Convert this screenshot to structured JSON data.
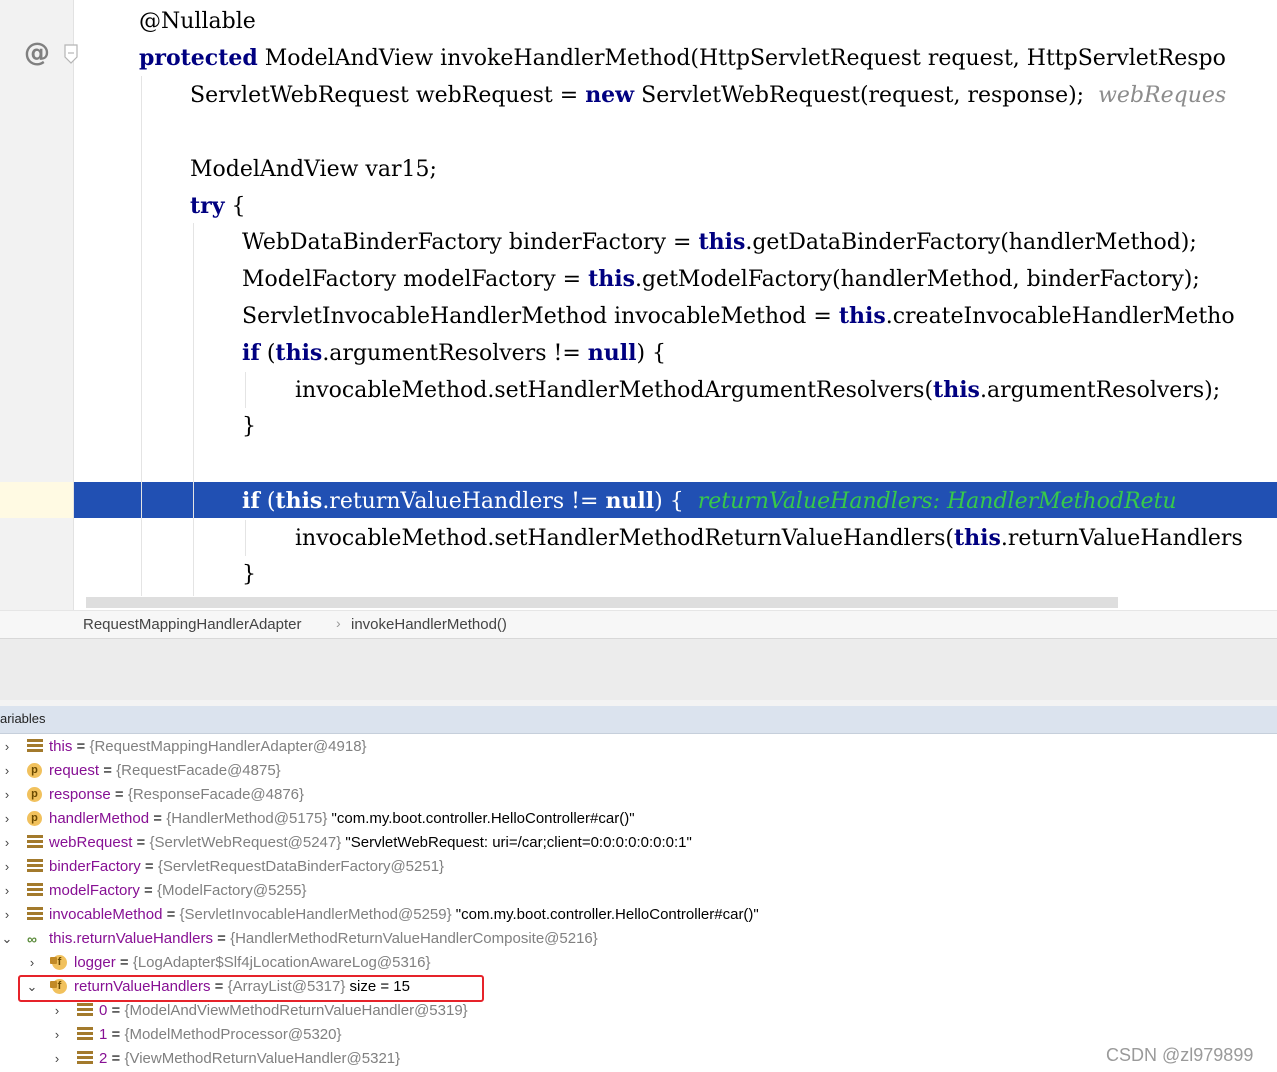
{
  "editor": {
    "gutter_at": "@",
    "lines": [
      {
        "segments": [
          {
            "t": "@Nullable"
          }
        ]
      },
      {
        "segments": [
          {
            "t": "protected",
            "c": "kw"
          },
          {
            "t": " ModelAndView invokeHandlerMethod(HttpServletRequest request, HttpServletRespo"
          }
        ]
      },
      {
        "segments": [
          {
            "t": "ServletWebRequest webRequest = "
          },
          {
            "t": "new",
            "c": "kw"
          },
          {
            "t": " ServletWebRequest(request, response);  "
          },
          {
            "t": "webReques",
            "c": "hint"
          }
        ]
      },
      {
        "segments": [
          {
            "t": "ModelAndView var15;"
          }
        ]
      },
      {
        "segments": [
          {
            "t": "try",
            "c": "kw"
          },
          {
            "t": " {"
          }
        ]
      },
      {
        "segments": [
          {
            "t": "WebDataBinderFactory binderFactory = "
          },
          {
            "t": "this",
            "c": "kw"
          },
          {
            "t": ".getDataBinderFactory(handlerMethod);"
          }
        ]
      },
      {
        "segments": [
          {
            "t": "ModelFactory modelFactory = "
          },
          {
            "t": "this",
            "c": "kw"
          },
          {
            "t": ".getModelFactory(handlerMethod, binderFactory);"
          }
        ]
      },
      {
        "segments": [
          {
            "t": "ServletInvocableHandlerMethod invocableMethod = "
          },
          {
            "t": "this",
            "c": "kw"
          },
          {
            "t": ".createInvocableHandlerMetho"
          }
        ]
      },
      {
        "segments": [
          {
            "t": "if",
            "c": "kw"
          },
          {
            "t": " ("
          },
          {
            "t": "this",
            "c": "kw"
          },
          {
            "t": ".argumentResolvers != "
          },
          {
            "t": "null",
            "c": "kw"
          },
          {
            "t": ") {"
          }
        ]
      },
      {
        "segments": [
          {
            "t": "invocableMethod.setHandlerMethodArgumentResolvers("
          },
          {
            "t": "this",
            "c": "kw"
          },
          {
            "t": ".argumentResolvers);"
          }
        ]
      },
      {
        "segments": [
          {
            "t": "}"
          }
        ]
      },
      {
        "segments": [
          {
            "t": "if",
            "c": "kw"
          },
          {
            "t": " ("
          },
          {
            "t": "this",
            "c": "kw"
          },
          {
            "t": ".returnValueHandlers != "
          },
          {
            "t": "null",
            "c": "kw"
          },
          {
            "t": ") {  "
          },
          {
            "t": "returnValueHandlers: HandlerMethodRetu",
            "c": "hint-green"
          }
        ]
      },
      {
        "segments": [
          {
            "t": "invocableMethod.setHandlerMethodReturnValueHandlers("
          },
          {
            "t": "this",
            "c": "kw"
          },
          {
            "t": ".returnValueHandlers"
          }
        ]
      },
      {
        "segments": [
          {
            "t": "}"
          }
        ]
      }
    ]
  },
  "breadcrumb": {
    "items": [
      "RequestMappingHandlerAdapter",
      "invokeHandlerMethod()"
    ],
    "separator": "›"
  },
  "variables_panel": {
    "title": "ariables",
    "rows": [
      {
        "arrow": "›",
        "icon": "list-icon",
        "name": "this",
        "eq": " = ",
        "value": "{RequestMappingHandlerAdapter@4918}",
        "str": ""
      },
      {
        "arrow": "›",
        "icon": "parameter-icon",
        "name": "request",
        "eq": " = ",
        "value": "{RequestFacade@4875}",
        "str": ""
      },
      {
        "arrow": "›",
        "icon": "parameter-icon",
        "name": "response",
        "eq": " = ",
        "value": "{ResponseFacade@4876}",
        "str": ""
      },
      {
        "arrow": "›",
        "icon": "parameter-icon",
        "name": "handlerMethod",
        "eq": " = ",
        "value": "{HandlerMethod@5175}",
        "str": " \"com.my.boot.controller.HelloController#car()\""
      },
      {
        "arrow": "›",
        "icon": "list-icon",
        "name": "webRequest",
        "eq": " = ",
        "value": "{ServletWebRequest@5247}",
        "str": " \"ServletWebRequest: uri=/car;client=0:0:0:0:0:0:0:1\""
      },
      {
        "arrow": "›",
        "icon": "list-icon",
        "name": "binderFactory",
        "eq": " = ",
        "value": "{ServletRequestDataBinderFactory@5251}",
        "str": ""
      },
      {
        "arrow": "›",
        "icon": "list-icon",
        "name": "modelFactory",
        "eq": " = ",
        "value": "{ModelFactory@5255}",
        "str": ""
      },
      {
        "arrow": "›",
        "icon": "list-icon",
        "name": "invocableMethod",
        "eq": " = ",
        "value": "{ServletInvocableHandlerMethod@5259}",
        "str": " \"com.my.boot.controller.HelloController#car()\""
      },
      {
        "arrow": "⌄",
        "icon": "watch-icon",
        "name": "this.returnValueHandlers",
        "eq": " = ",
        "value": "{HandlerMethodReturnValueHandlerComposite@5216}",
        "str": ""
      },
      {
        "arrow": "›",
        "icon": "field-icon",
        "name": "logger",
        "eq": " = ",
        "value": "{LogAdapter$Slf4jLocationAwareLog@5316}",
        "str": ""
      },
      {
        "arrow": "⌄",
        "icon": "field-icon",
        "name": "returnValueHandlers",
        "eq": " = ",
        "value": "{ArrayList@5317}",
        "str": "  size = 15"
      },
      {
        "arrow": "›",
        "icon": "list-icon",
        "name": "0",
        "eq": " = ",
        "value": "{ModelAndViewMethodReturnValueHandler@5319}",
        "str": ""
      },
      {
        "arrow": "›",
        "icon": "list-icon",
        "name": "1",
        "eq": " = ",
        "value": "{ModelMethodProcessor@5320}",
        "str": ""
      },
      {
        "arrow": "›",
        "icon": "list-icon",
        "name": "2",
        "eq": " = ",
        "value": "{ViewMethodReturnValueHandler@5321}",
        "str": ""
      }
    ]
  },
  "watermark": "CSDN @zl979899",
  "colors": {
    "keyword": "#000080",
    "highlight_line": "#2150b3",
    "variable_name": "#871094",
    "annotation_box": "#e6232a",
    "inline_hint_green": "#37c94a"
  }
}
